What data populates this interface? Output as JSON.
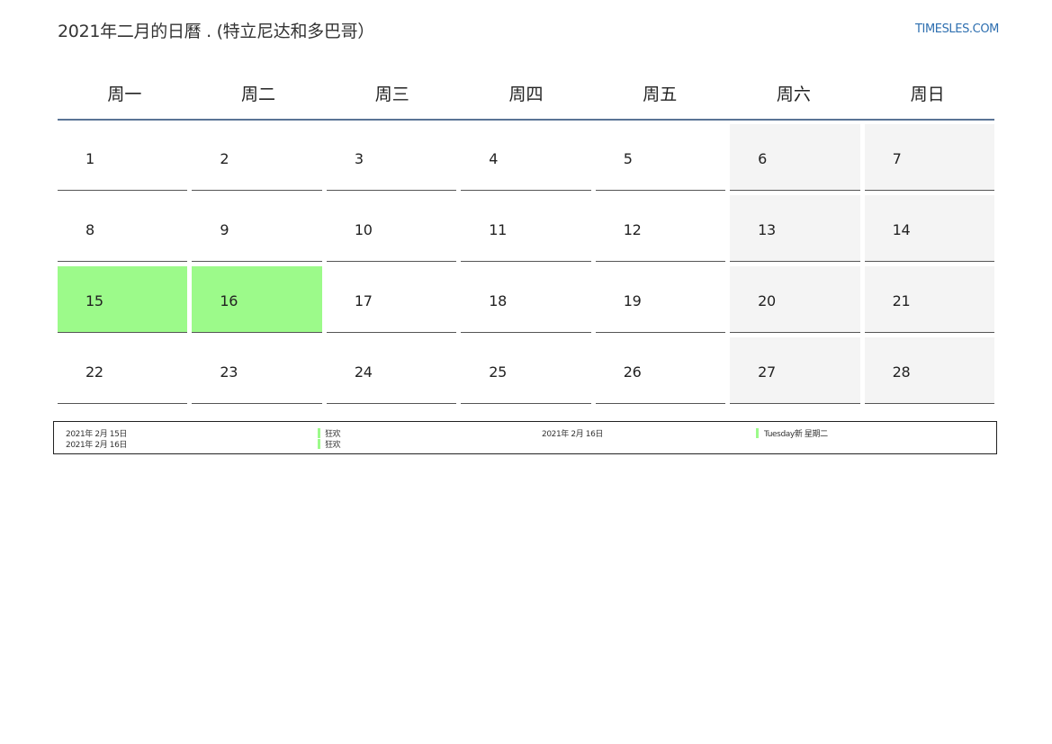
{
  "header": {
    "title": "2021年二月的日曆 . (特立尼达和多巴哥）",
    "brand": "TIMESLES.COM"
  },
  "weekdays": [
    "周一",
    "周二",
    "周三",
    "周四",
    "周五",
    "周六",
    "周日"
  ],
  "weeks": [
    [
      "1",
      "2",
      "3",
      "4",
      "5",
      "6",
      "7"
    ],
    [
      "8",
      "9",
      "10",
      "11",
      "12",
      "13",
      "14"
    ],
    [
      "15",
      "16",
      "17",
      "18",
      "19",
      "20",
      "21"
    ],
    [
      "22",
      "23",
      "24",
      "25",
      "26",
      "27",
      "28"
    ]
  ],
  "holiday_days": [
    "15",
    "16"
  ],
  "colors": {
    "holiday": "#9cfa8a",
    "weekend": "#f4f4f4",
    "header_rule": "#5a7496",
    "brand": "#2e6fb0"
  },
  "legend": {
    "col1": [
      {
        "date": "2021年 2月 15日",
        "name": "狂欢"
      },
      {
        "date": "2021年 2月 16日",
        "name": "狂欢"
      }
    ],
    "col2": [
      {
        "date": "2021年 2月 16日",
        "name": "Tuesday新 星期二"
      }
    ]
  }
}
